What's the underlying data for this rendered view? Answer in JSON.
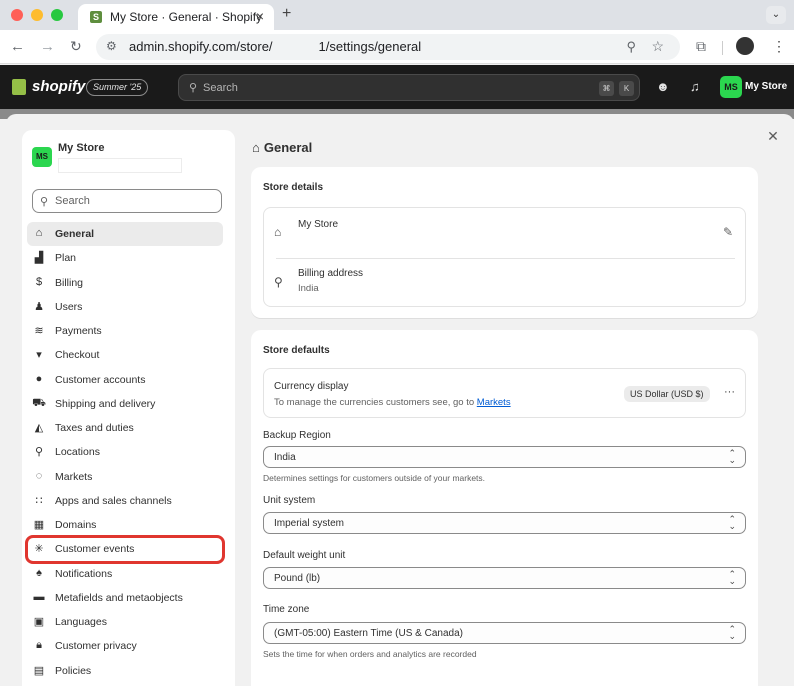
{
  "browser": {
    "tab_title": "My Store · General · Shopify",
    "tab_close": "×",
    "new_tab": "+",
    "url_prefix": "admin.shopify.com/store/",
    "url_suffix": "1/settings/general",
    "colors": {
      "close": "#ff5f57",
      "minimize": "#febc2e",
      "maximize": "#28c840"
    }
  },
  "topbar": {
    "brand": "shopify",
    "edition": "Summer '25",
    "search_placeholder": "Search",
    "shortcut_key1": "⌘",
    "shortcut_key2": "K",
    "avatar_initials": "MS",
    "store_name": "My Store"
  },
  "sidebar": {
    "avatar_initials": "MS",
    "store_name": "My Store",
    "search_placeholder": "Search",
    "items": [
      {
        "icon": "store-icon",
        "label": "General"
      },
      {
        "icon": "plan-icon",
        "label": "Plan"
      },
      {
        "icon": "billing-icon",
        "label": "Billing"
      },
      {
        "icon": "users-icon",
        "label": "Users"
      },
      {
        "icon": "payments-icon",
        "label": "Payments"
      },
      {
        "icon": "cart-icon",
        "label": "Checkout"
      },
      {
        "icon": "person-icon",
        "label": "Customer accounts"
      },
      {
        "icon": "truck-icon",
        "label": "Shipping and delivery"
      },
      {
        "icon": "tax-icon",
        "label": "Taxes and duties"
      },
      {
        "icon": "location-icon",
        "label": "Locations"
      },
      {
        "icon": "globe-icon",
        "label": "Markets"
      },
      {
        "icon": "apps-icon",
        "label": "Apps and sales channels"
      },
      {
        "icon": "domain-icon",
        "label": "Domains"
      },
      {
        "icon": "events-icon",
        "label": "Customer events"
      },
      {
        "icon": "bell-icon",
        "label": "Notifications"
      },
      {
        "icon": "metafields-icon",
        "label": "Metafields and metaobjects"
      },
      {
        "icon": "language-icon",
        "label": "Languages"
      },
      {
        "icon": "lock-icon",
        "label": "Customer privacy"
      },
      {
        "icon": "policy-icon",
        "label": "Policies"
      }
    ]
  },
  "main": {
    "title": "General",
    "store_details": {
      "heading": "Store details",
      "store_name": "My Store",
      "billing_label": "Billing address",
      "billing_value": "India"
    },
    "store_defaults": {
      "heading": "Store defaults",
      "currency_label": "Currency display",
      "currency_help_prefix": "To manage the currencies customers see, go to",
      "currency_help_link": "Markets",
      "currency_value": "US Dollar (USD $)",
      "more": "···",
      "backup_region_label": "Backup Region",
      "backup_region_value": "India",
      "backup_region_help": "Determines settings for customers outside of your markets.",
      "unit_system_label": "Unit system",
      "unit_system_value": "Imperial system",
      "weight_label": "Default weight unit",
      "weight_value": "Pound (lb)",
      "timezone_label": "Time zone",
      "timezone_value": "(GMT-05:00) Eastern Time (US & Canada)",
      "timezone_help": "Sets the time for when orders and analytics are recorded"
    }
  }
}
